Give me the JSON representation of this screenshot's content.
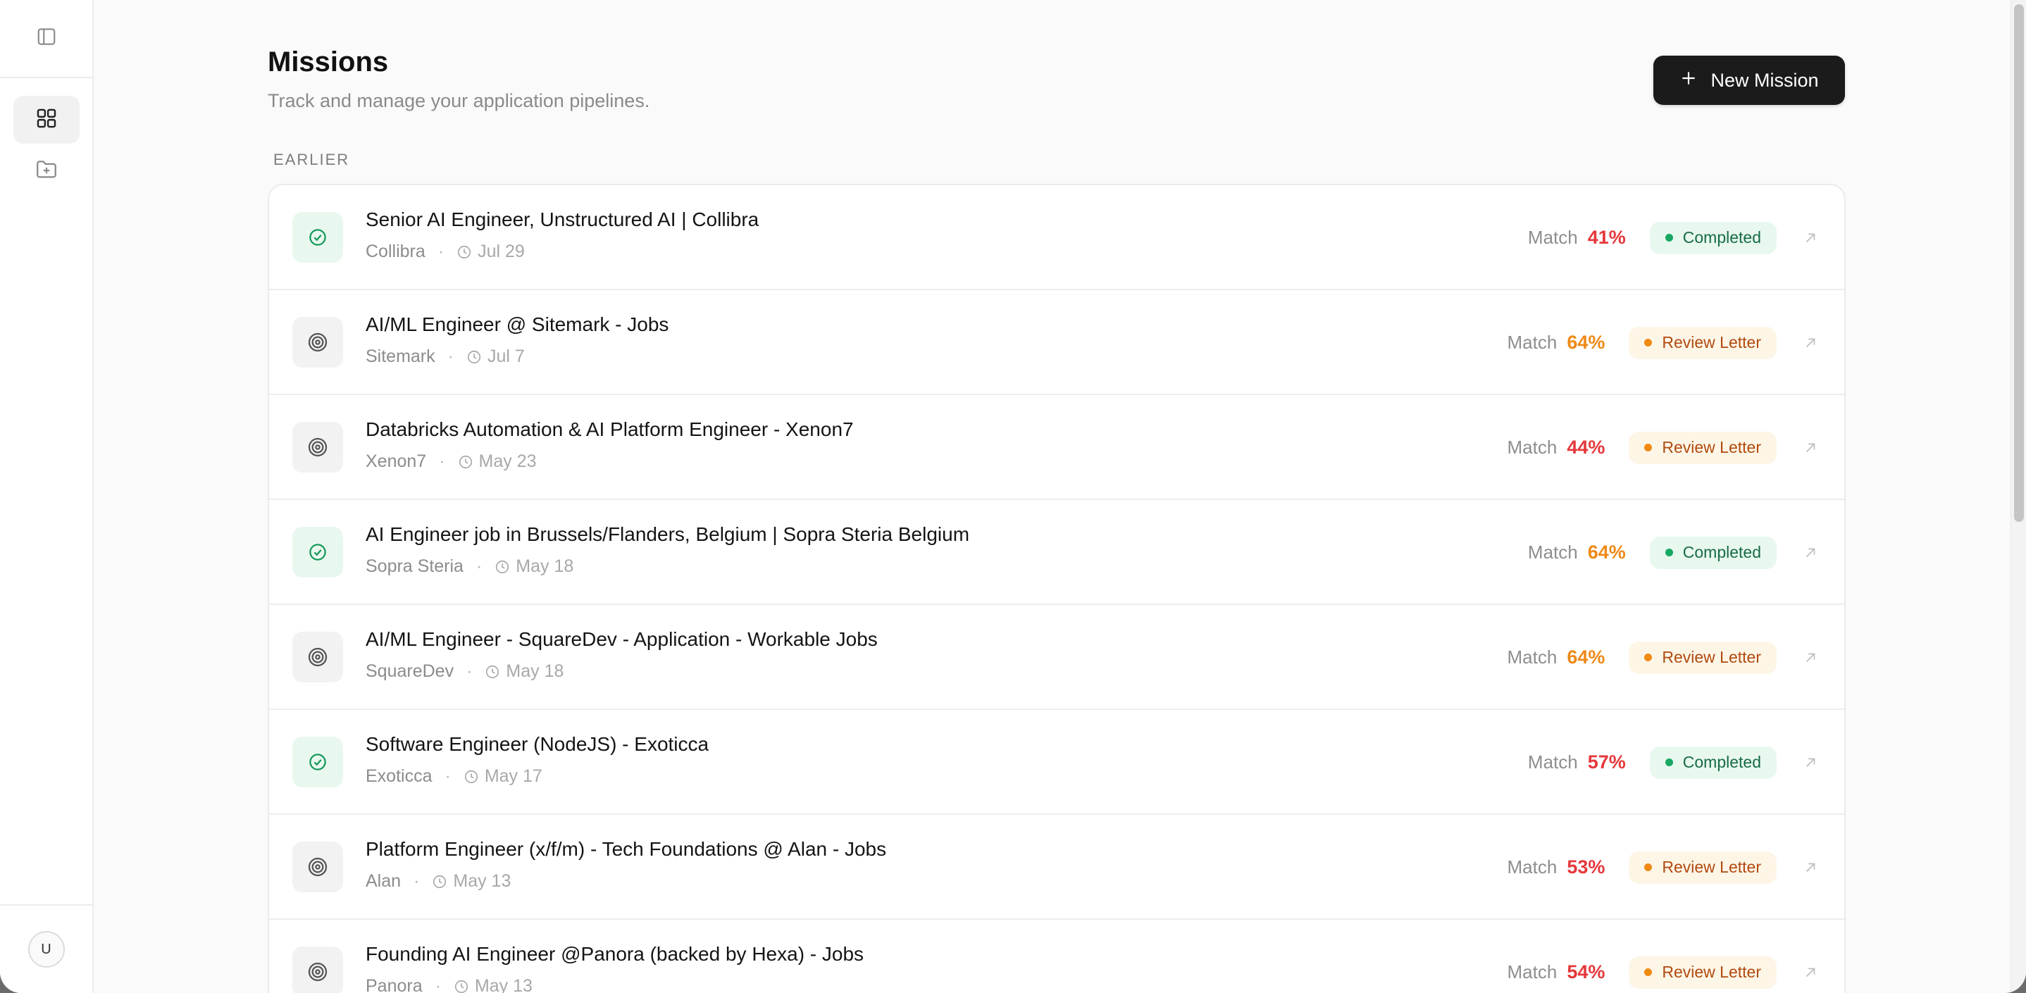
{
  "header": {
    "title": "Missions",
    "subtitle": "Track and manage your application pipelines.",
    "new_button_label": "New Mission"
  },
  "sidebar": {
    "toggle_icon": "sidebar-toggle-icon",
    "items": [
      {
        "icon": "grid-icon",
        "active": true
      },
      {
        "icon": "folder-plus-icon",
        "active": false
      }
    ],
    "avatar_initial": "U"
  },
  "section_label": "EARLIER",
  "missions": [
    {
      "title": "Senior AI Engineer, Unstructured AI | Collibra",
      "company": "Collibra",
      "date": "Jul 29",
      "match_label": "Match",
      "match": "41%",
      "match_color": "#e5383b",
      "status": "Completed",
      "status_type": "done"
    },
    {
      "title": "AI/ML Engineer @ Sitemark - Jobs",
      "company": "Sitemark",
      "date": "Jul 7",
      "match_label": "Match",
      "match": "64%",
      "match_color": "#ee8a18",
      "status": "Review Letter",
      "status_type": "review"
    },
    {
      "title": "Databricks Automation & AI Platform Engineer - Xenon7",
      "company": "Xenon7",
      "date": "May 23",
      "match_label": "Match",
      "match": "44%",
      "match_color": "#e5383b",
      "status": "Review Letter",
      "status_type": "review"
    },
    {
      "title": "AI Engineer job in Brussels/Flanders, Belgium | Sopra Steria Belgium",
      "company": "Sopra Steria",
      "date": "May 18",
      "match_label": "Match",
      "match": "64%",
      "match_color": "#ee8a18",
      "status": "Completed",
      "status_type": "done"
    },
    {
      "title": "AI/ML Engineer - SquareDev - Application - Workable Jobs",
      "company": "SquareDev",
      "date": "May 18",
      "match_label": "Match",
      "match": "64%",
      "match_color": "#ee8a18",
      "status": "Review Letter",
      "status_type": "review"
    },
    {
      "title": "Software Engineer (NodeJS) - Exoticca",
      "company": "Exoticca",
      "date": "May 17",
      "match_label": "Match",
      "match": "57%",
      "match_color": "#e5383b",
      "status": "Completed",
      "status_type": "done"
    },
    {
      "title": "Platform Engineer (x/f/m) - Tech Foundations @ Alan - Jobs",
      "company": "Alan",
      "date": "May 13",
      "match_label": "Match",
      "match": "53%",
      "match_color": "#e5383b",
      "status": "Review Letter",
      "status_type": "review"
    },
    {
      "title": "Founding AI Engineer @Panora (backed by Hexa) - Jobs",
      "company": "Panora",
      "date": "May 13",
      "match_label": "Match",
      "match": "54%",
      "match_color": "#e5383b",
      "status": "Review Letter",
      "status_type": "review"
    }
  ]
}
